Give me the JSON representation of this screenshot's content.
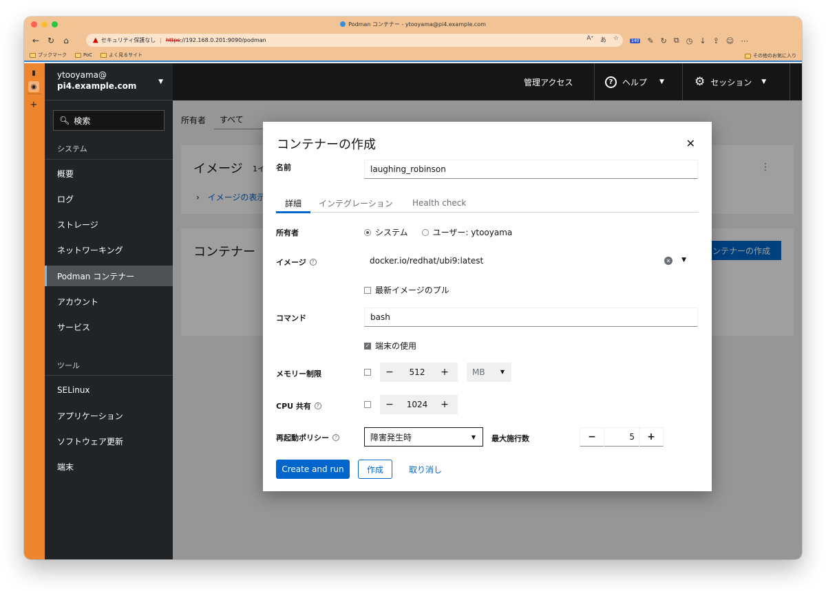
{
  "browser": {
    "window_title": "Podman コンテナー - ytooyama@pi4.example.com",
    "security_warning": "セキュリティ保護なし",
    "url_scheme": "https",
    "url_rest": "://192.168.0.201:9090/podman",
    "tracker_badge": "140",
    "bookmarks": [
      {
        "label": "ブックマーク"
      },
      {
        "label": "PoC"
      },
      {
        "label": "よく見るサイト"
      }
    ],
    "other_bookmarks": "その他のお気に入り"
  },
  "sidebar": {
    "host_user": "ytooyama@",
    "host_name": "pi4.example.com",
    "search_label": "検索",
    "section_system": "システム",
    "section_tools": "ツール",
    "system_items": [
      {
        "label": "概要"
      },
      {
        "label": "ログ"
      },
      {
        "label": "ストレージ"
      },
      {
        "label": "ネットワーキング"
      },
      {
        "label": "Podman コンテナー"
      },
      {
        "label": "アカウント"
      },
      {
        "label": "サービス"
      }
    ],
    "tool_items": [
      {
        "label": "SELinux"
      },
      {
        "label": "アプリケーション"
      },
      {
        "label": "ソフトウェア更新"
      },
      {
        "label": "端末"
      }
    ]
  },
  "masthead": {
    "admin_access": "管理アクセス",
    "help": "ヘルプ",
    "session": "セッション"
  },
  "page": {
    "owner_label": "所有者",
    "owner_value": "すべて",
    "images_title": "イメージ",
    "images_count_fragment": "1イ",
    "show_images_link": "イメージの表示",
    "containers_title": "コンテナー",
    "create_container_fragment": "ンテナーの作成"
  },
  "modal": {
    "title": "コンテナーの作成",
    "name_label": "名前",
    "name_value": "laughing_robinson",
    "tabs": [
      {
        "label": "詳細"
      },
      {
        "label": "インテグレーション"
      },
      {
        "label": "Health check"
      }
    ],
    "owner_label": "所有者",
    "owner_system": "システム",
    "owner_user": "ユーザー: ytooyama",
    "image_label": "イメージ",
    "image_value": "docker.io/redhat/ubi9:latest",
    "pull_latest": "最新イメージのプル",
    "command_label": "コマンド",
    "command_value": "bash",
    "use_terminal": "端末の使用",
    "memory_label": "メモリー制限",
    "memory_value": "512",
    "memory_unit": "MB",
    "cpu_label": "CPU 共有",
    "cpu_value": "1024",
    "restart_label": "再起動ポリシー",
    "restart_value": "障害発生時",
    "max_retry_label": "最大施行数",
    "max_retry_value": "5",
    "create_and_run": "Create and run",
    "create": "作成",
    "cancel": "取り消し"
  },
  "colors": {
    "accent": "#0066cc",
    "rail": "#ee8630",
    "sidebar_bg": "#212427",
    "masthead_bg": "#151515"
  }
}
